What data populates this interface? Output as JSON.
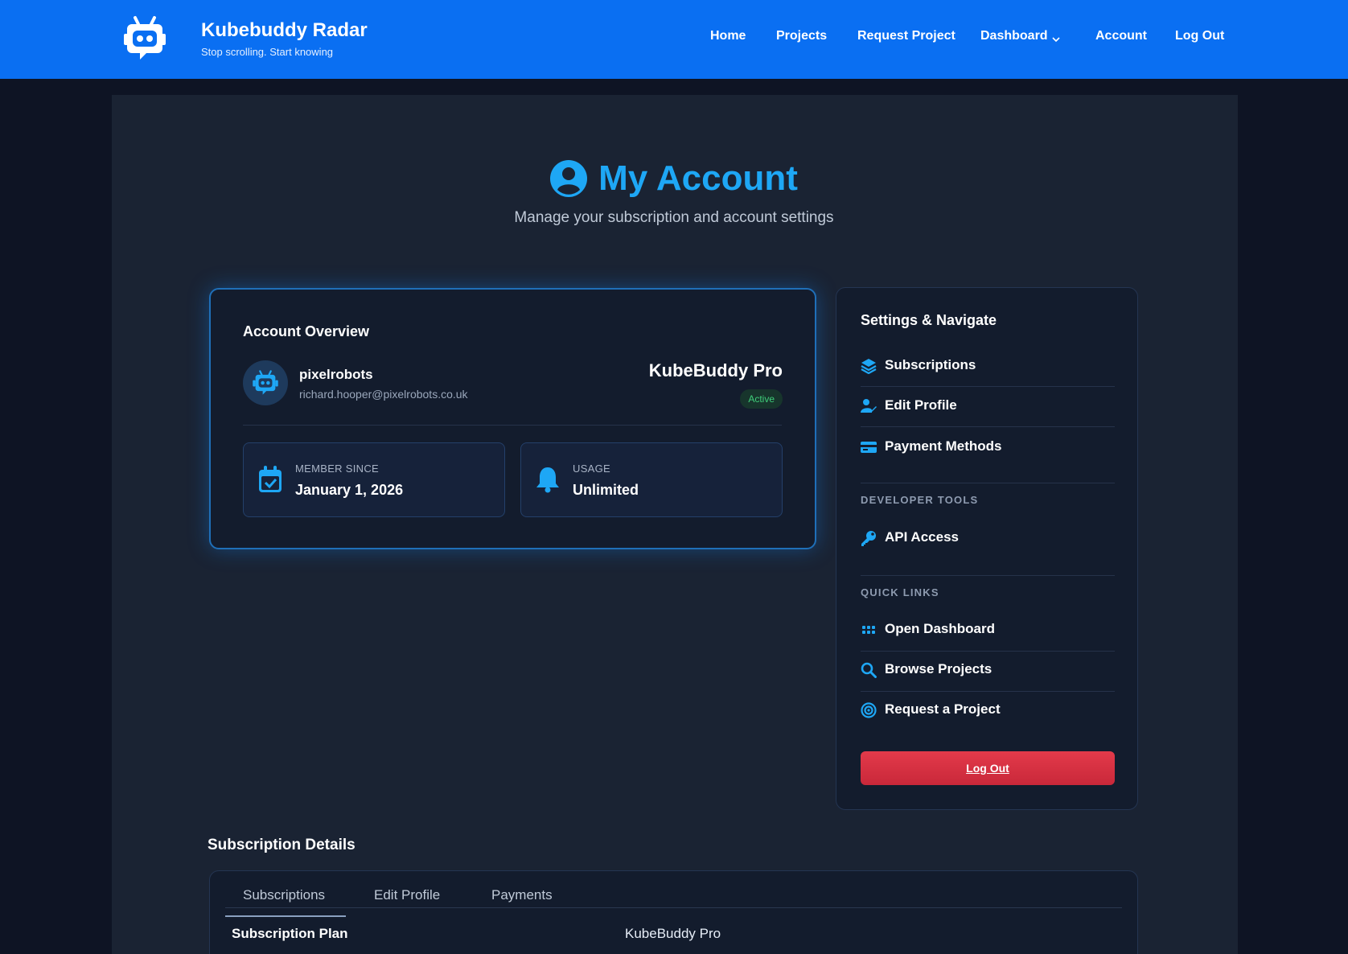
{
  "brand": {
    "name": "Kubebuddy Radar",
    "tagline": "Stop scrolling. Start knowing"
  },
  "nav": {
    "home": "Home",
    "projects": "Projects",
    "request_project": "Request Project",
    "dashboard": "Dashboard",
    "account": "Account",
    "logout": "Log Out"
  },
  "page": {
    "title": "My Account",
    "subtitle": "Manage your subscription and account settings"
  },
  "overview": {
    "heading": "Account Overview",
    "username": "pixelrobots",
    "email": "richard.hooper@pixelrobots.co.uk",
    "plan": "KubeBuddy Pro",
    "status": "Active",
    "member_since_label": "MEMBER SINCE",
    "member_since_value": "January 1, 2026",
    "usage_label": "USAGE",
    "usage_value": "Unlimited"
  },
  "settings": {
    "heading": "Settings & Navigate",
    "items": [
      {
        "label": "Subscriptions",
        "icon": "layers-icon"
      },
      {
        "label": "Edit Profile",
        "icon": "user-edit-icon"
      },
      {
        "label": "Payment Methods",
        "icon": "credit-card-icon"
      }
    ],
    "developer_tools_heading": "DEVELOPER TOOLS",
    "developer_items": [
      {
        "label": "API Access",
        "icon": "key-icon"
      }
    ],
    "quick_links_heading": "QUICK LINKS",
    "quick_links": [
      {
        "label": "Open Dashboard",
        "icon": "grid-icon"
      },
      {
        "label": "Browse Projects",
        "icon": "search-icon"
      },
      {
        "label": "Request a Project",
        "icon": "target-icon"
      }
    ],
    "logout": "Log Out"
  },
  "subscription": {
    "heading": "Subscription Details",
    "tabs": [
      "Subscriptions",
      "Edit Profile",
      "Payments"
    ],
    "rows": [
      {
        "label": "Subscription Plan",
        "value": "KubeBuddy Pro"
      }
    ]
  },
  "colors": {
    "header": "#0a6ff2",
    "accent": "#1ea7f5",
    "panel": "#1a2333",
    "card": "#131c2d",
    "active_badge": "#3fcf7a",
    "logout": "#d8303f"
  }
}
